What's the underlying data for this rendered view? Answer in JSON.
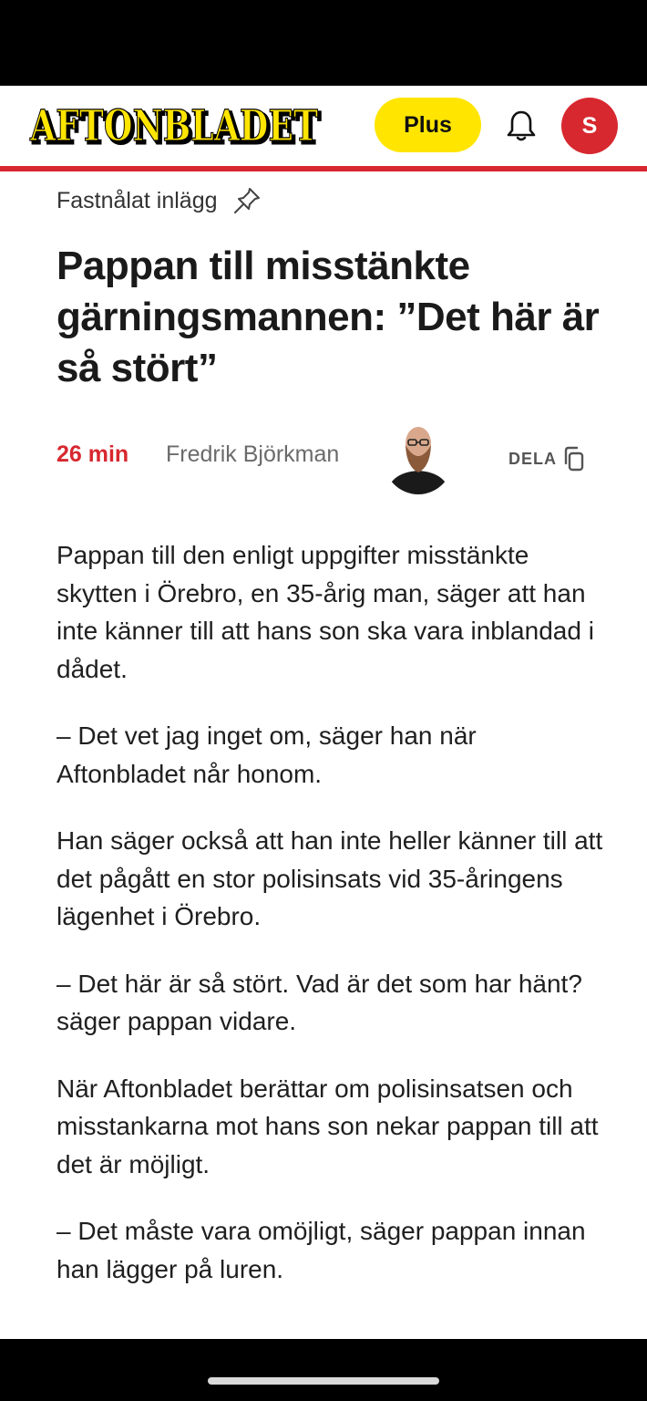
{
  "header": {
    "logo_text": "AFTONBLADET",
    "plus_label": "Plus",
    "avatar_initial": "S",
    "colors": {
      "brand_yellow": "#ffe500",
      "brand_red": "#d7282f"
    }
  },
  "article": {
    "pinned_label": "Fastnålat inlägg",
    "headline": "Pappan till misstänkte gärningsmannen: ”Det här är så stört”",
    "time_ago": "26 min",
    "author": "Fredrik Björkman",
    "share_label": "DELA",
    "paragraphs": [
      "Pappan till den enligt uppgifter misstänkte skytten i Örebro, en 35-årig man, säger att han inte känner till att hans son ska vara inblandad i dådet.",
      "– Det vet jag inget om, säger han när Aftonbladet når honom.",
      "Han säger också att han inte heller känner till att det pågått en stor polisinsats vid 35-åringens lägenhet i Örebro.",
      "– Det här är så stört. Vad är det som har hänt? säger pappan vidare.",
      "När Aftonbladet berättar om polisinsatsen och misstankarna mot hans son nekar pappan till att det är möjligt.",
      "– Det måste vara omöjligt, säger pappan innan han lägger på luren."
    ]
  },
  "icons": {
    "bell": "bell-icon",
    "pin": "pin-icon",
    "copy": "copy-icon"
  }
}
